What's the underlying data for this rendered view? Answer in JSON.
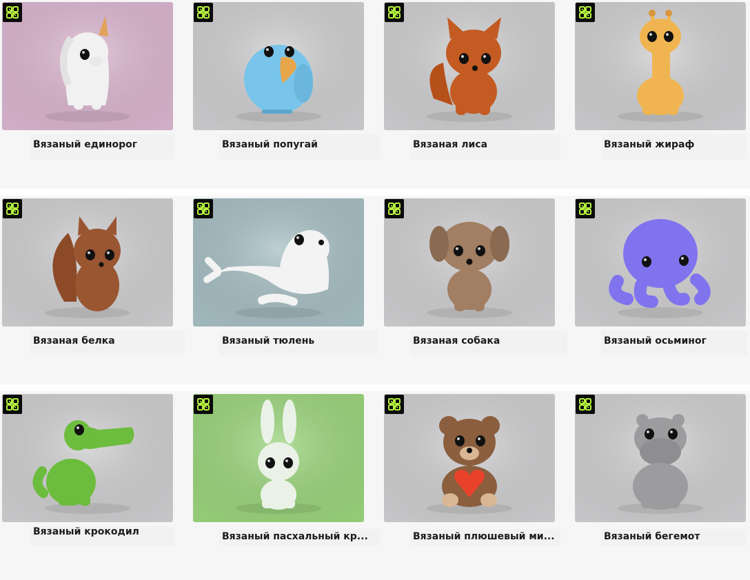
{
  "product_grid": {
    "items": [
      {
        "title": "Вязаный единорог",
        "bg": "#dbb6d0",
        "body": "#f1f1f1",
        "icon": "unicorn"
      },
      {
        "title": "Вязаный попугай",
        "bg": "#cfcfd1",
        "body": "#78c4ea",
        "icon": "parrot"
      },
      {
        "title": "Вязаная лиса",
        "bg": "#cfcfd1",
        "body": "#c35b22",
        "icon": "fox"
      },
      {
        "title": "Вязаный жираф",
        "bg": "#cfcfd1",
        "body": "#f0b551",
        "icon": "giraffe"
      },
      {
        "title": "Вязаная белка",
        "bg": "#cfcfd1",
        "body": "#9a5531",
        "icon": "squirrel"
      },
      {
        "title": "Вязаный тюлень",
        "bg": "#a7bfc4",
        "body": "#f3f3f3",
        "icon": "seal"
      },
      {
        "title": "Вязаная собака",
        "bg": "#cfcfd1",
        "body": "#a27e62",
        "icon": "dog"
      },
      {
        "title": "Вязаный осьминог",
        "bg": "#cfcfd1",
        "body": "#8073ee",
        "icon": "octopus"
      },
      {
        "title": "Вязаный крокодил",
        "bg": "#cfcfd1",
        "body": "#6cbc3d",
        "icon": "crocodile"
      },
      {
        "title": "Вязаный пасхальный кр...",
        "bg": "#9bd57c",
        "body": "#eaf2e8",
        "icon": "bunny"
      },
      {
        "title": "Вязаный плюшевый ми...",
        "bg": "#cfcfd1",
        "body": "#8b5e3e",
        "icon": "teddy-bear"
      },
      {
        "title": "Вязаный бегемот",
        "bg": "#cfcfd1",
        "body": "#9c9c9f",
        "icon": "hippo"
      }
    ]
  },
  "badge": {
    "icon": "brand-logo-icon",
    "bg": "#0b0b0b",
    "fg": "#b7f23c"
  }
}
